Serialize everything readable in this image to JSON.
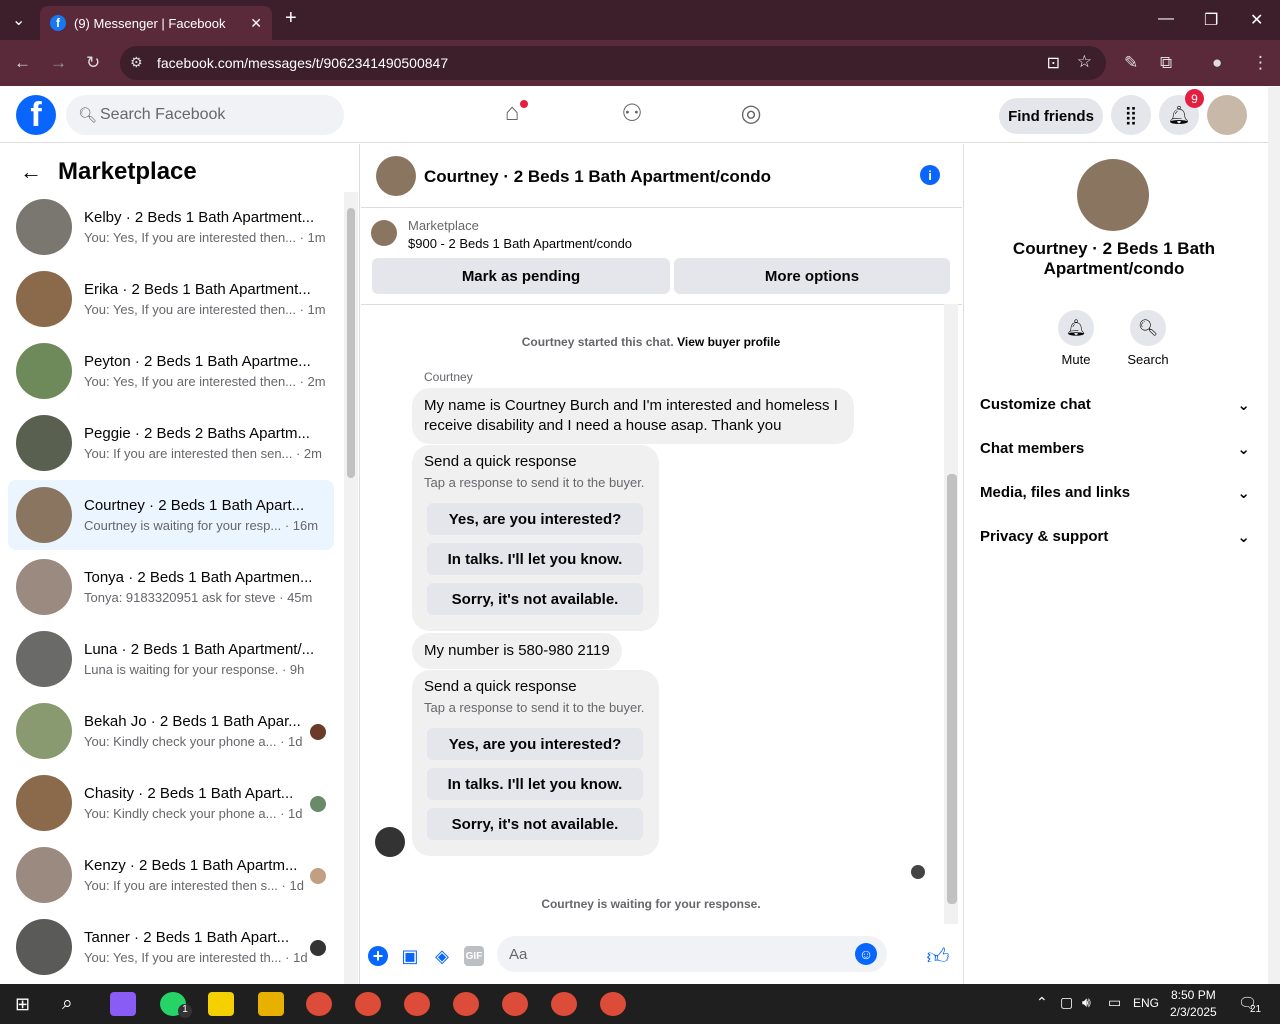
{
  "browser": {
    "tab_title": "(9) Messenger | Facebook",
    "url": "facebook.com/messages/t/9062341490500847"
  },
  "header": {
    "search_placeholder": "Search Facebook",
    "find_friends": "Find friends",
    "notif_count": "9"
  },
  "sidebar": {
    "title": "Marketplace",
    "items": [
      {
        "name": "Kelby · 2 Beds 1 Bath Apartment...",
        "preview": "You: Yes, If you are interested then... · 1m",
        "color": "#7a7770"
      },
      {
        "name": "Erika · 2 Beds 1 Bath Apartment...",
        "preview": "You: Yes, If you are interested then... · 1m",
        "color": "#8a6a4a"
      },
      {
        "name": "Peyton · 2 Beds 1 Bath Apartme...",
        "preview": "You: Yes, If you are interested then... · 2m",
        "color": "#6f8a5a"
      },
      {
        "name": "Peggie · 2 Beds 2 Baths Apartm...",
        "preview": "You: If you are interested then sen... · 2m",
        "color": "#5a6050"
      },
      {
        "name": "Courtney · 2 Beds 1 Bath Apart...",
        "preview": "Courtney is waiting for your resp... · 16m",
        "color": "#8a7660"
      },
      {
        "name": "Tonya · 2 Beds 1 Bath Apartmen...",
        "preview": "Tonya: 9183320951 ask for steve · 45m",
        "color": "#9a8a80"
      },
      {
        "name": "Luna · 2 Beds 1 Bath Apartment/...",
        "preview": "Luna is waiting for your response. · 9h",
        "color": "#6a6a68"
      },
      {
        "name": "Bekah Jo · 2 Beds 1 Bath Apar...",
        "preview": "You: Kindly check your phone a... · 1d",
        "color": "#8a9a70"
      },
      {
        "name": "Chasity · 2 Beds 1 Bath Apart...",
        "preview": "You: Kindly check your phone a... · 1d",
        "color": "#8a6a4a"
      },
      {
        "name": "Kenzy · 2 Beds 1 Bath Apartm...",
        "preview": "You: If you are interested then s... · 1d",
        "color": "#9a8a80"
      },
      {
        "name": "Tanner · 2 Beds 1 Bath Apart...",
        "preview": "You: Yes, If you are interested th... · 1d",
        "color": "#5a5a58"
      }
    ]
  },
  "chat": {
    "title": "Courtney · 2 Beds 1 Bath Apartment/condo",
    "listing_label": "Marketplace",
    "listing_price": "$900 - 2 Beds 1 Bath Apartment/condo",
    "mark_pending": "Mark as pending",
    "more_options": "More options",
    "started_text": "Courtney started this chat.",
    "view_profile": "View buyer profile",
    "sender": "Courtney",
    "msg1": "My name is Courtney Burch and I'm interested and homeless I receive disability and I need a house asap.  Thank you",
    "msg2": "My number is  580-980 2119",
    "qr_title": "Send a quick response",
    "qr_sub": "Tap a response to send it to the buyer.",
    "qr_opts": [
      "Yes, are you interested?",
      "In talks. I'll let you know.",
      "Sorry, it's not available."
    ],
    "waiting": "Courtney is waiting for your response.",
    "composer_placeholder": "Aa"
  },
  "details": {
    "title": "Courtney · 2 Beds 1 Bath Apartment/condo",
    "mute": "Mute",
    "search": "Search",
    "sections": [
      "Customize chat",
      "Chat members",
      "Media, files and links",
      "Privacy & support"
    ]
  },
  "taskbar": {
    "lang": "ENG",
    "time": "8:50 PM",
    "date": "2/3/2025",
    "notif": "21",
    "whatsapp_badge": "1"
  }
}
